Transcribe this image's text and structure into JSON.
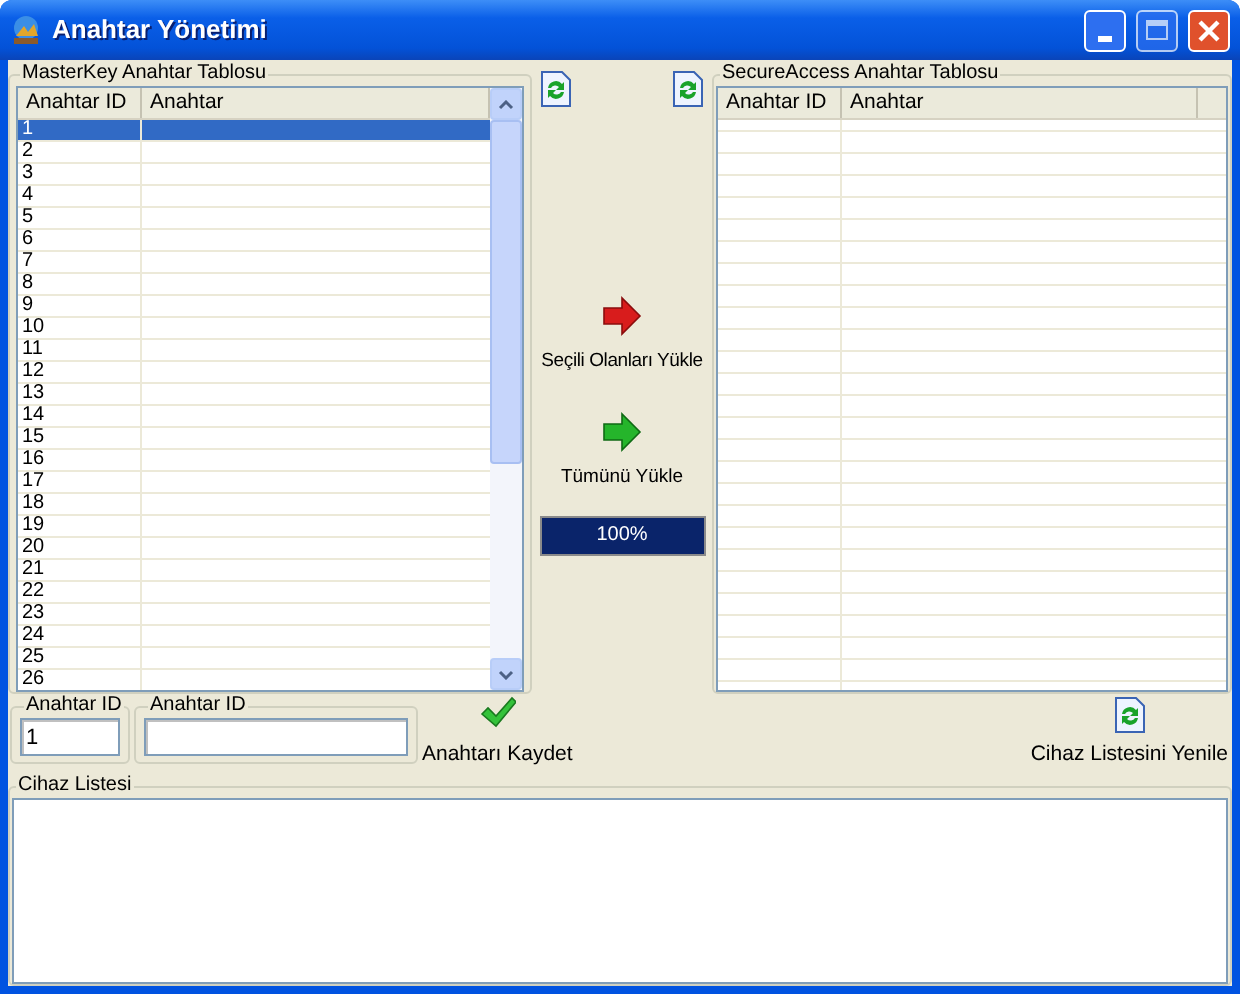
{
  "window": {
    "title": "Anahtar Yönetimi"
  },
  "masterkey_table": {
    "title": "MasterKey Anahtar Tablosu",
    "columns": [
      "Anahtar ID",
      "Anahtar"
    ],
    "rows": [
      {
        "number": "1",
        "selected": true
      },
      {
        "number": "2",
        "selected": false
      },
      {
        "number": "3",
        "selected": false
      },
      {
        "number": "4",
        "selected": false
      },
      {
        "number": "5",
        "selected": false
      },
      {
        "number": "6",
        "selected": false
      },
      {
        "number": "7",
        "selected": false
      },
      {
        "number": "8",
        "selected": false
      },
      {
        "number": "9",
        "selected": false
      },
      {
        "number": "10",
        "selected": false
      },
      {
        "number": "11",
        "selected": false
      },
      {
        "number": "12",
        "selected": false
      },
      {
        "number": "13",
        "selected": false
      },
      {
        "number": "14",
        "selected": false
      },
      {
        "number": "15",
        "selected": false
      },
      {
        "number": "16",
        "selected": false
      },
      {
        "number": "17",
        "selected": false
      },
      {
        "number": "18",
        "selected": false
      },
      {
        "number": "19",
        "selected": false
      },
      {
        "number": "20",
        "selected": false
      },
      {
        "number": "21",
        "selected": false
      },
      {
        "number": "22",
        "selected": false
      },
      {
        "number": "23",
        "selected": false
      },
      {
        "number": "24",
        "selected": false
      },
      {
        "number": "25",
        "selected": false
      },
      {
        "number": "26",
        "selected": false
      }
    ]
  },
  "transfer": {
    "load_selected": "Seçili Olanları Yükle",
    "load_all": "Tümünü Yükle",
    "progress": {
      "level": 1,
      "text": "100%"
    }
  },
  "secureaccess_table": {
    "title": "SecureAccess Anahtar Tablosu",
    "columns": [
      "Anahtar ID",
      "Anahtar"
    ]
  },
  "key_form": {
    "fields": [
      {
        "label": "Anahtar ID",
        "value": "1"
      },
      {
        "label": "Anahtar ID"
      }
    ],
    "save_button": "Anahtarı Kaydet"
  },
  "refresh_devices_button": "Cihaz Listesini Yenile",
  "device_list": {
    "title": "Cihaz Listesi"
  }
}
